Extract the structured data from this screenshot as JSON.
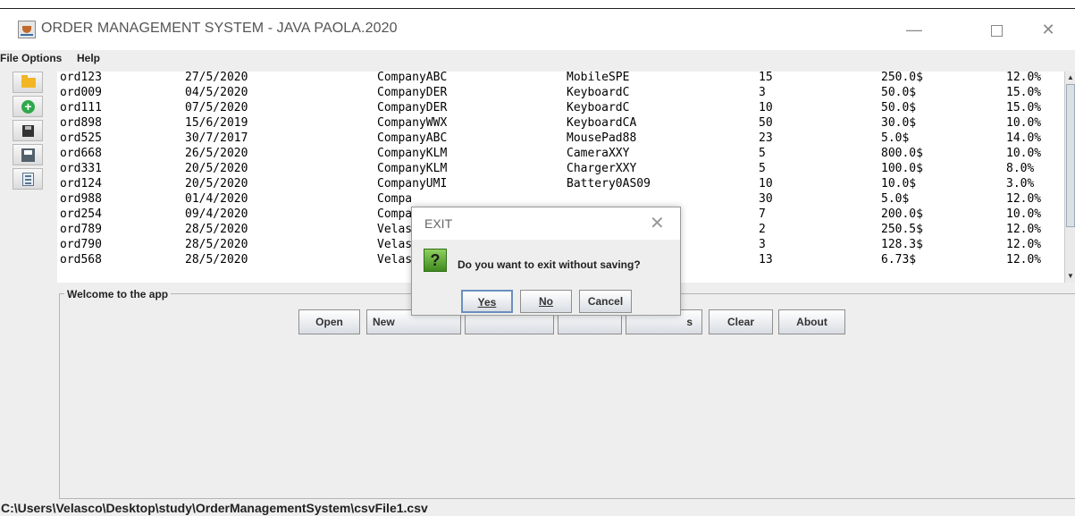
{
  "window": {
    "title": "ORDER MANAGEMENT SYSTEM - JAVA PAOLA.2020",
    "minimize_glyph": "—",
    "close_glyph": "✕"
  },
  "menu": {
    "file": "File",
    "options": "Options",
    "help": "Help"
  },
  "toolbar": {
    "icons": [
      "open-folder-icon",
      "add-icon",
      "save-icon",
      "save-as-icon",
      "calculator-icon"
    ]
  },
  "orders": [
    [
      "ord123",
      "27/5/2020",
      "CompanyABC",
      "MobileSPE",
      "15",
      "250.0$",
      "12.0%"
    ],
    [
      "ord009",
      "04/5/2020",
      "CompanyDER",
      "KeyboardC",
      "3",
      "50.0$",
      "15.0%"
    ],
    [
      "ord111",
      "07/5/2020",
      "CompanyDER",
      "KeyboardC",
      "10",
      "50.0$",
      "15.0%"
    ],
    [
      "ord898",
      "15/6/2019",
      "CompanyWWX",
      "KeyboardCA",
      "50",
      "30.0$",
      "10.0%"
    ],
    [
      "ord525",
      "30/7/2017",
      "CompanyABC",
      "MousePad88",
      "23",
      "5.0$",
      "14.0%"
    ],
    [
      "ord668",
      "26/5/2020",
      "CompanyKLM",
      "CameraXXY",
      "5",
      "800.0$",
      "10.0%"
    ],
    [
      "ord331",
      "20/5/2020",
      "CompanyKLM",
      "ChargerXXY",
      "5",
      "100.0$",
      "8.0%"
    ],
    [
      "ord124",
      "20/5/2020",
      "CompanyUMI",
      "Battery0AS09",
      "10",
      "10.0$",
      "3.0%"
    ],
    [
      "ord988",
      "01/4/2020",
      "Compa",
      "",
      "30",
      "5.0$",
      "12.0%"
    ],
    [
      "ord254",
      "09/4/2020",
      "Compa",
      "",
      "7",
      "200.0$",
      "10.0%"
    ],
    [
      "ord789",
      "28/5/2020",
      "Velas",
      "",
      "2",
      "250.5$",
      "12.0%"
    ],
    [
      "ord790",
      "28/5/2020",
      "Velas",
      "",
      "3",
      "128.3$",
      "12.0%"
    ],
    [
      "ord568",
      "28/5/2020",
      "Velas",
      "",
      "13",
      "6.73$",
      "12.0%"
    ]
  ],
  "panel": {
    "legend": "Welcome to the app",
    "buttons": {
      "open": "Open",
      "new": "New",
      "hidden3": "",
      "hidden4": "",
      "save_as_tail": "s",
      "clear": "Clear",
      "about": "About"
    }
  },
  "status": {
    "path": "C:\\Users\\Velasco\\Desktop\\study\\OrderManagementSystem\\csvFile1.csv"
  },
  "dialog": {
    "title": "EXIT",
    "close_glyph": "✕",
    "question_glyph": "?",
    "message": "Do you want to exit  without saving?",
    "yes": "Yes",
    "no": "No",
    "cancel": "Cancel"
  },
  "colors": {
    "accent_default_button": "#6a8fbf",
    "question_icon": "#3f8a1f",
    "folder_icon": "#f3b623",
    "add_icon": "#2fa84a"
  }
}
